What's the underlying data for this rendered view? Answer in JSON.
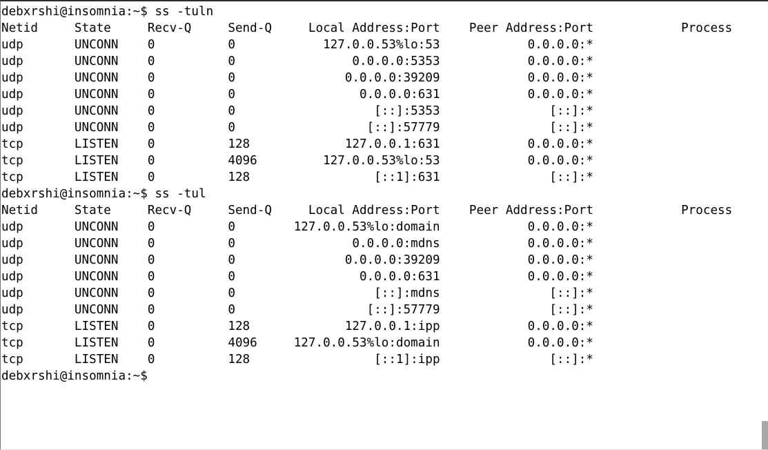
{
  "terminal": {
    "shell_user": "debxrshi",
    "shell_host": "insomnia",
    "shell_cwd": "~",
    "prompt": "debxrshi@insomnia:~$",
    "foreground_color": "#000000",
    "background_color": "#ffffff",
    "scrollbar_color": "#a8a8a8",
    "columns": {
      "netid": 0,
      "state": 10,
      "recv_q": 20,
      "send_q": 31,
      "local_address_end": 60,
      "peer_address_end": 81,
      "process": 93
    },
    "sessions": [
      {
        "command": "ss -tuln",
        "command_line": "debxrshi@insomnia:~$ ss -tuln",
        "headers": {
          "netid": "Netid",
          "state": "State",
          "recv_q": "Recv-Q",
          "send_q": "Send-Q",
          "local": "Local Address:Port",
          "peer": "Peer Address:Port",
          "process": "Process"
        },
        "rows": [
          {
            "netid": "udp",
            "state": "UNCONN",
            "recv_q": "0",
            "send_q": "0",
            "local": "127.0.0.53%lo:53",
            "peer": "0.0.0.0:*",
            "process": ""
          },
          {
            "netid": "udp",
            "state": "UNCONN",
            "recv_q": "0",
            "send_q": "0",
            "local": "0.0.0.0:5353",
            "peer": "0.0.0.0:*",
            "process": ""
          },
          {
            "netid": "udp",
            "state": "UNCONN",
            "recv_q": "0",
            "send_q": "0",
            "local": "0.0.0.0:39209",
            "peer": "0.0.0.0:*",
            "process": ""
          },
          {
            "netid": "udp",
            "state": "UNCONN",
            "recv_q": "0",
            "send_q": "0",
            "local": "0.0.0.0:631",
            "peer": "0.0.0.0:*",
            "process": ""
          },
          {
            "netid": "udp",
            "state": "UNCONN",
            "recv_q": "0",
            "send_q": "0",
            "local": "[::]:5353",
            "peer": "[::]:*",
            "process": ""
          },
          {
            "netid": "udp",
            "state": "UNCONN",
            "recv_q": "0",
            "send_q": "0",
            "local": "[::]:57779",
            "peer": "[::]:*",
            "process": ""
          },
          {
            "netid": "tcp",
            "state": "LISTEN",
            "recv_q": "0",
            "send_q": "128",
            "local": "127.0.0.1:631",
            "peer": "0.0.0.0:*",
            "process": ""
          },
          {
            "netid": "tcp",
            "state": "LISTEN",
            "recv_q": "0",
            "send_q": "4096",
            "local": "127.0.0.53%lo:53",
            "peer": "0.0.0.0:*",
            "process": ""
          },
          {
            "netid": "tcp",
            "state": "LISTEN",
            "recv_q": "0",
            "send_q": "128",
            "local": "[::1]:631",
            "peer": "[::]:*",
            "process": ""
          }
        ]
      },
      {
        "command": "ss -tul",
        "command_line": "debxrshi@insomnia:~$ ss -tul",
        "headers": {
          "netid": "Netid",
          "state": "State",
          "recv_q": "Recv-Q",
          "send_q": "Send-Q",
          "local": "Local Address:Port",
          "peer": "Peer Address:Port",
          "process": "Process"
        },
        "rows": [
          {
            "netid": "udp",
            "state": "UNCONN",
            "recv_q": "0",
            "send_q": "0",
            "local": "127.0.0.53%lo:domain",
            "peer": "0.0.0.0:*",
            "process": ""
          },
          {
            "netid": "udp",
            "state": "UNCONN",
            "recv_q": "0",
            "send_q": "0",
            "local": "0.0.0.0:mdns",
            "peer": "0.0.0.0:*",
            "process": ""
          },
          {
            "netid": "udp",
            "state": "UNCONN",
            "recv_q": "0",
            "send_q": "0",
            "local": "0.0.0.0:39209",
            "peer": "0.0.0.0:*",
            "process": ""
          },
          {
            "netid": "udp",
            "state": "UNCONN",
            "recv_q": "0",
            "send_q": "0",
            "local": "0.0.0.0:631",
            "peer": "0.0.0.0:*",
            "process": ""
          },
          {
            "netid": "udp",
            "state": "UNCONN",
            "recv_q": "0",
            "send_q": "0",
            "local": "[::]:mdns",
            "peer": "[::]:*",
            "process": ""
          },
          {
            "netid": "udp",
            "state": "UNCONN",
            "recv_q": "0",
            "send_q": "0",
            "local": "[::]:57779",
            "peer": "[::]:*",
            "process": ""
          },
          {
            "netid": "tcp",
            "state": "LISTEN",
            "recv_q": "0",
            "send_q": "128",
            "local": "127.0.0.1:ipp",
            "peer": "0.0.0.0:*",
            "process": ""
          },
          {
            "netid": "tcp",
            "state": "LISTEN",
            "recv_q": "0",
            "send_q": "4096",
            "local": "127.0.0.53%lo:domain",
            "peer": "0.0.0.0:*",
            "process": ""
          },
          {
            "netid": "tcp",
            "state": "LISTEN",
            "recv_q": "0",
            "send_q": "128",
            "local": "[::1]:ipp",
            "peer": "[::]:*",
            "process": ""
          }
        ]
      }
    ],
    "trailing_prompt": "debxrshi@insomnia:~$"
  }
}
